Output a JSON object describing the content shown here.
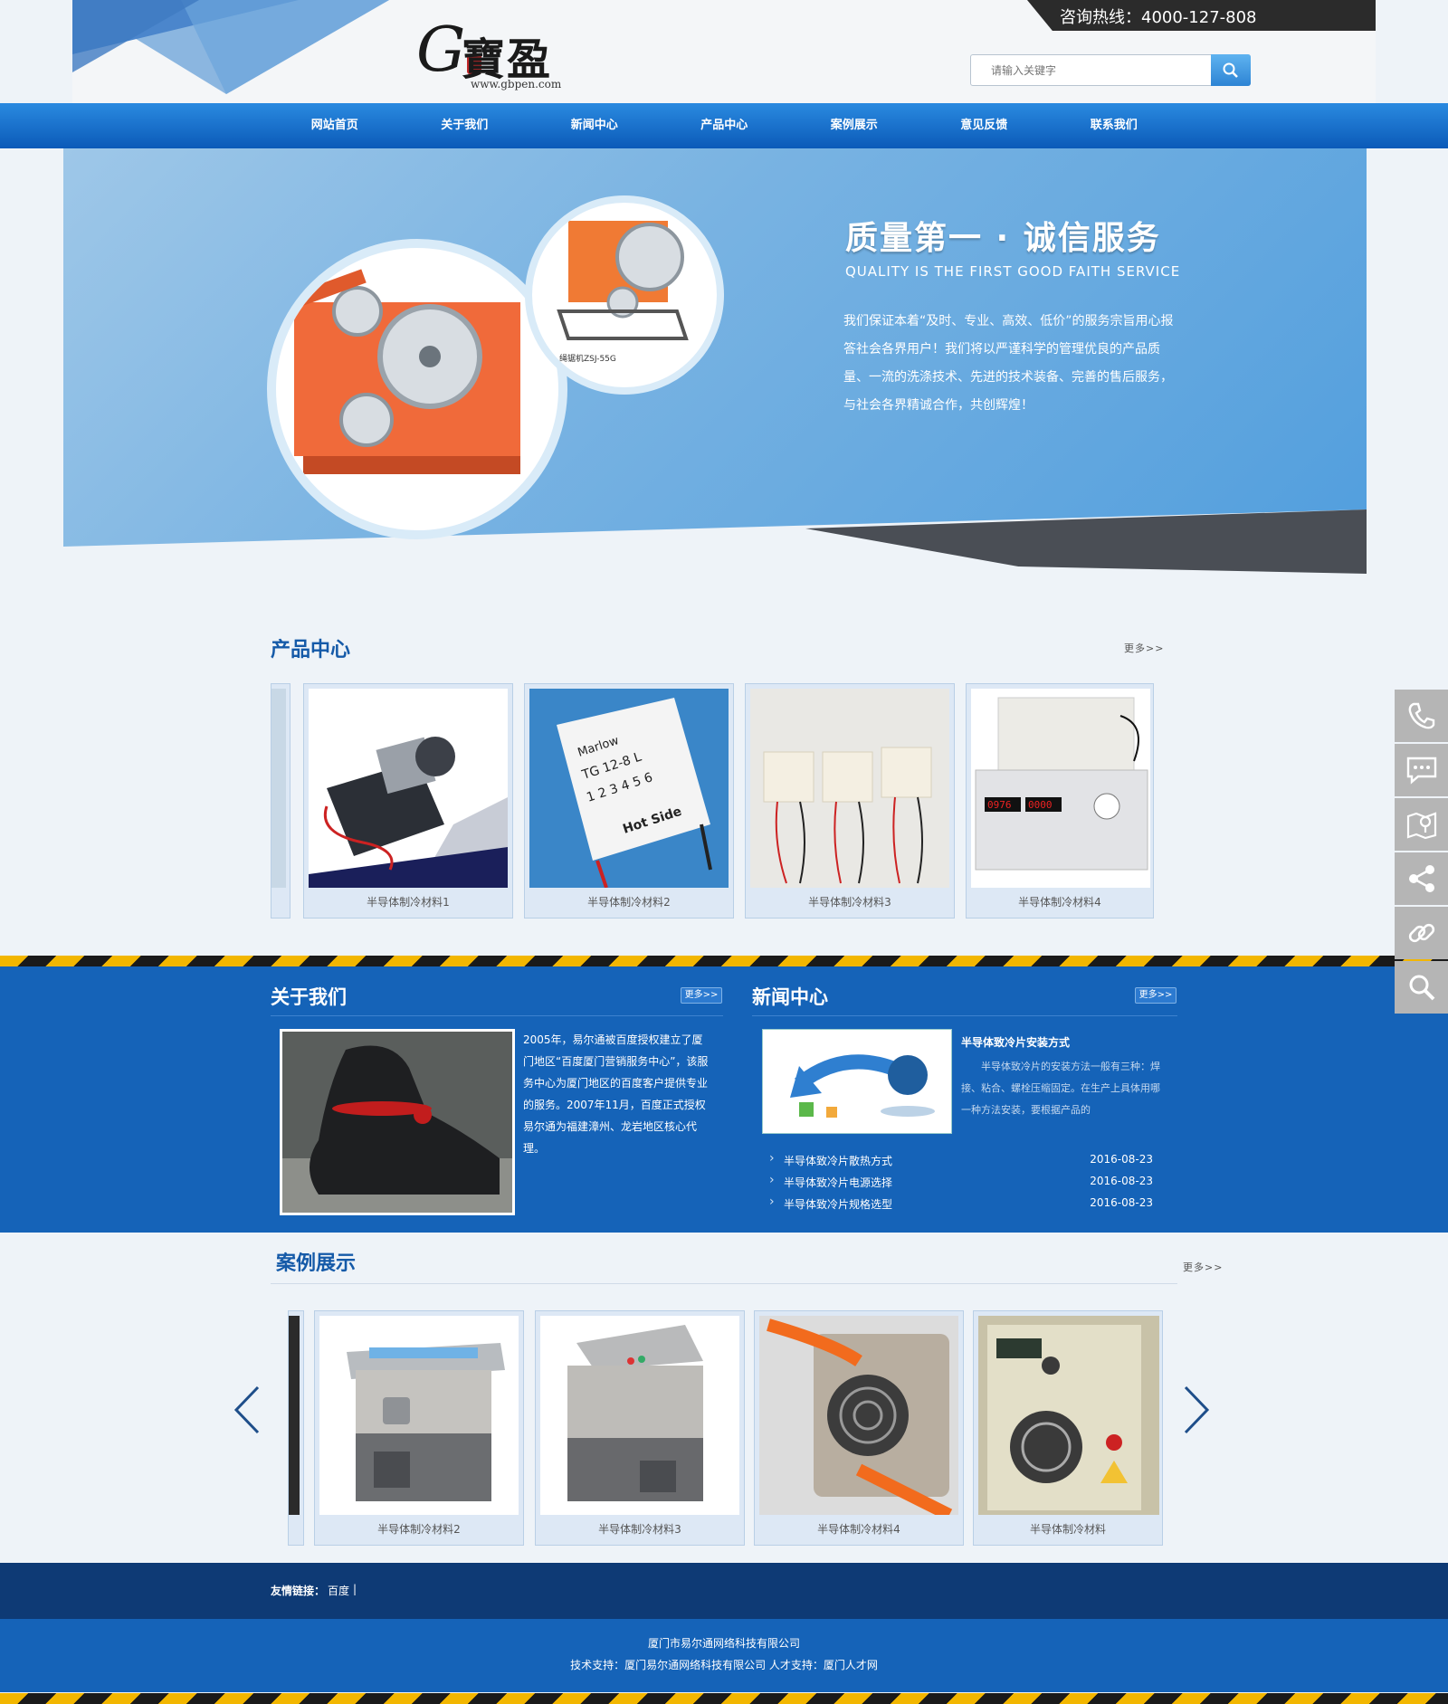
{
  "header": {
    "logo_text": "寶盈",
    "logo_letter": "G",
    "logo_url": "www.gbpen.com",
    "hotline": "咨询热线：4000-127-808",
    "search_placeholder": "请输入关键字"
  },
  "nav": [
    "网站首页",
    "关于我们",
    "新闻中心",
    "产品中心",
    "案例展示",
    "意见反馈",
    "联系我们"
  ],
  "banner": {
    "slogan": "质量第一 · 诚信服务",
    "slogan_en": "QUALITY IS THE FIRST GOOD FAITH SERVICE",
    "description": "我们保证本着“及时、专业、高效、低价”的服务宗旨用心报答社会各界用户！我们将以严谨科学的管理优良的产品质量、一流的洗涤技术、先进的技术装备、完善的售后服务，与社会各界精诚合作，共创辉煌！",
    "machine_label": "绳锯机ZSJ-55G"
  },
  "products": {
    "title": "产品中心",
    "more": "更多>>",
    "items": [
      "半导体制冷材料1",
      "半导体制冷材料2",
      "半导体制冷材料3",
      "半导体制冷材料4"
    ]
  },
  "about": {
    "title": "关于我们",
    "more": "更多>>",
    "text": "2005年，易尔通被百度授权建立了厦门地区“百度厦门营销服务中心”，该服务中心为厦门地区的百度客户提供专业的服务。2007年11月，百度正式授权易尔通为福建漳州、龙岩地区核心代理。"
  },
  "news": {
    "title": "新闻中心",
    "more": "更多>>",
    "headline": "半导体致冷片安装方式",
    "summary": "半导体致冷片的安装方法一般有三种：焊接、粘合、螺栓压缩固定。在生产上具体用哪一种方法安装，要根据产品的",
    "list": [
      {
        "title": "半导体致冷片散热方式",
        "date": "2016-08-23"
      },
      {
        "title": "半导体致冷片电源选择",
        "date": "2016-08-23"
      },
      {
        "title": "半导体致冷片规格选型",
        "date": "2016-08-23"
      }
    ]
  },
  "cases": {
    "title": "案例展示",
    "more": "更多>>",
    "items": [
      "半导体制冷材料2",
      "半导体制冷材料3",
      "半导体制冷材料4",
      "半导体制冷材料"
    ]
  },
  "links": {
    "label": "友情链接：",
    "items": [
      "百度"
    ]
  },
  "footer": {
    "company": "厦门市易尔通网络科技有限公司",
    "support": "技术支持：厦门易尔通网络科技有限公司 人才支持：厦门人才网"
  },
  "side_tools": [
    "phone-icon",
    "message-icon",
    "map-icon",
    "share-icon",
    "link-icon",
    "search-icon"
  ],
  "colors": {
    "primary": "#1563b8",
    "nav": "#0b5ab8",
    "dark": "#0e3a75",
    "accent_stripe": "#f2b600"
  }
}
